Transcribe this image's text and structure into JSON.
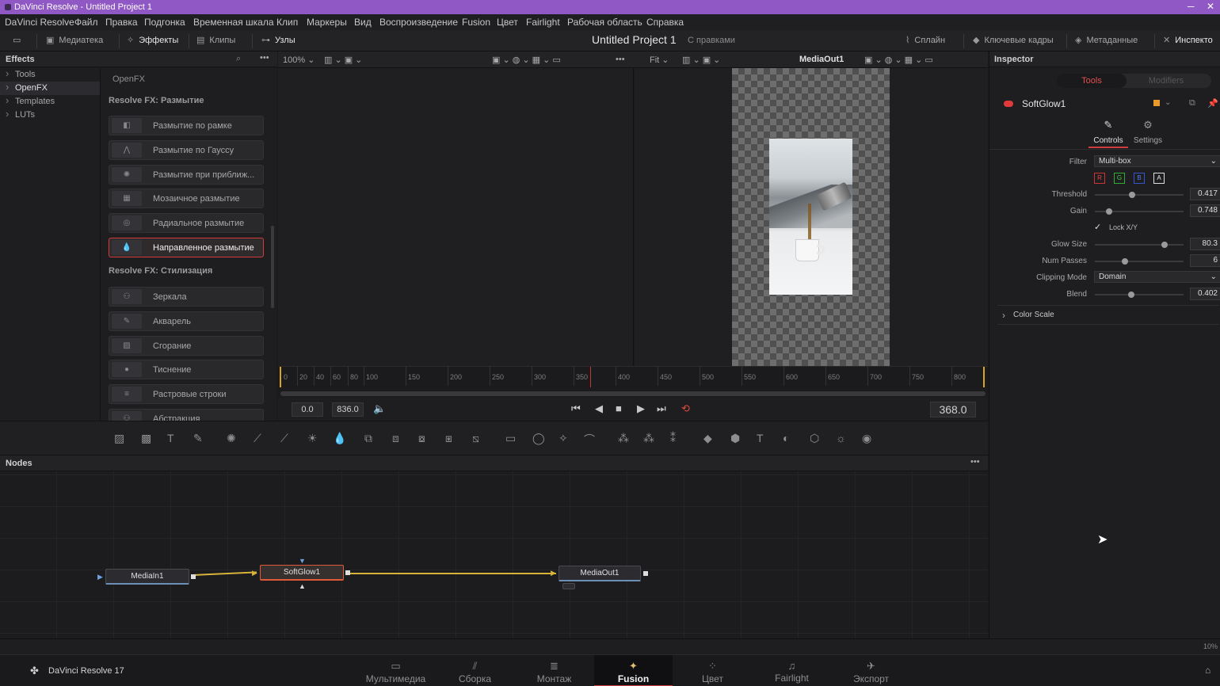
{
  "window": {
    "title": "DaVinci Resolve - Untitled Project 1"
  },
  "menu": [
    "DaVinci Resolve",
    "Файл",
    "Правка",
    "Подгонка",
    "Временная шкала",
    "Клип",
    "Маркеры",
    "Вид",
    "Воспроизведение",
    "Fusion",
    "Цвет",
    "Fairlight",
    "Рабочая область",
    "Справка"
  ],
  "toolbar": {
    "media_pool": "Медиатека",
    "effects": "Эффекты",
    "clips": "Клипы",
    "nodes": "Узлы",
    "project_title": "Untitled Project 1",
    "project_status": "С правками",
    "spline": "Сплайн",
    "keyframes": "Ключевые кадры",
    "metadata": "Метаданные",
    "inspector": "Инспекто"
  },
  "effects": {
    "header": "Effects",
    "tree": [
      "Tools",
      "OpenFX",
      "Templates",
      "LUTs"
    ],
    "selected_tree": "OpenFX",
    "breadcrumb": "OpenFX",
    "category_blur": "Resolve FX: Размытие",
    "blur_items": [
      "Размытие по рамке",
      "Размытие по Гауссу",
      "Размытие при приближ...",
      "Мозаичное размытие",
      "Радиальное размытие",
      "Направленное размытие"
    ],
    "category_stylize": "Resolve FX: Стилизация",
    "stylize_items": [
      "Зеркала",
      "Акварель",
      "Сгорание",
      "Тиснение",
      "Растровые строки",
      "Абстракция"
    ]
  },
  "viewer": {
    "left_zoom": "100%",
    "right_zoom": "Fit",
    "right_title": "MediaOut1",
    "ticks": [
      "0",
      "20",
      "40",
      "60",
      "80",
      "100",
      "150",
      "200",
      "250",
      "300",
      "350",
      "400",
      "450",
      "500",
      "550",
      "600",
      "650",
      "700",
      "750",
      "800"
    ],
    "start_field": "0.0",
    "end_field": "836.0",
    "current_frame": "368.0"
  },
  "nodes": {
    "header": "Nodes",
    "media_in": "MediaIn1",
    "soft_glow": "SoftGlow1",
    "media_out": "MediaOut1"
  },
  "inspector": {
    "header": "Inspector",
    "tab_tools": "Tools",
    "tab_modifiers": "Modifiers",
    "tool_name": "SoftGlow1",
    "subtab_controls": "Controls",
    "subtab_settings": "Settings",
    "filter_label": "Filter",
    "filter_value": "Multi-box",
    "channels": [
      "R",
      "G",
      "B",
      "A"
    ],
    "threshold_label": "Threshold",
    "threshold": "0.417",
    "gain_label": "Gain",
    "gain": "0.748",
    "lock_label": "Lock X/Y",
    "glow_size_label": "Glow Size",
    "glow_size": "80.3",
    "num_passes_label": "Num Passes",
    "num_passes": "6",
    "clipping_label": "Clipping Mode",
    "clipping_value": "Domain",
    "blend_label": "Blend",
    "blend": "0.402",
    "color_scale": "Color Scale"
  },
  "status": {
    "zoom": "10%"
  },
  "pages": {
    "brand": "DaVinci Resolve 17",
    "tabs": [
      "Мультимедиа",
      "Сборка",
      "Монтаж",
      "Fusion",
      "Цвет",
      "Fairlight",
      "Экспорт"
    ],
    "active": "Fusion"
  },
  "colors": {
    "accent": "#d23b3b",
    "titlebar": "#8f58c4",
    "wire": "#d9b23a"
  }
}
